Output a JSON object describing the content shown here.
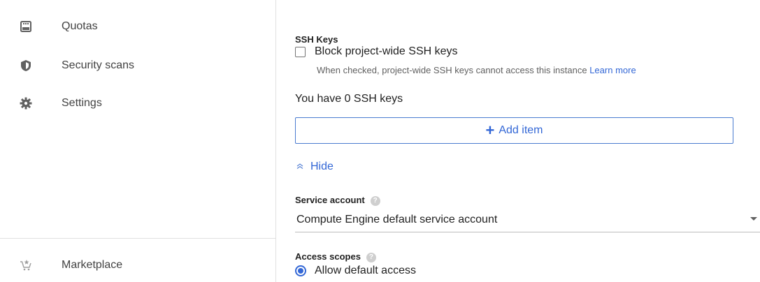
{
  "sidebar": {
    "items": [
      {
        "label": "Quotas",
        "icon": "quotas-icon"
      },
      {
        "label": "Security scans",
        "icon": "shield-icon"
      },
      {
        "label": "Settings",
        "icon": "gear-icon"
      },
      {
        "label": "Marketplace",
        "icon": "marketplace-cart-icon"
      }
    ]
  },
  "ssh": {
    "title": "SSH Keys",
    "block_label": "Block project-wide SSH keys",
    "block_checked": false,
    "hint_text": "When checked, project-wide SSH keys cannot access this instance",
    "learn_more": "Learn more",
    "count_text": "You have 0 SSH keys",
    "add_item": "Add item",
    "hide": "Hide"
  },
  "service_account": {
    "label": "Service account",
    "value": "Compute Engine default service account"
  },
  "access_scopes": {
    "label": "Access scopes",
    "option": "Allow default access",
    "selected": true
  },
  "colors": {
    "accent": "#3367d6",
    "text": "#212121",
    "muted": "#616161"
  }
}
